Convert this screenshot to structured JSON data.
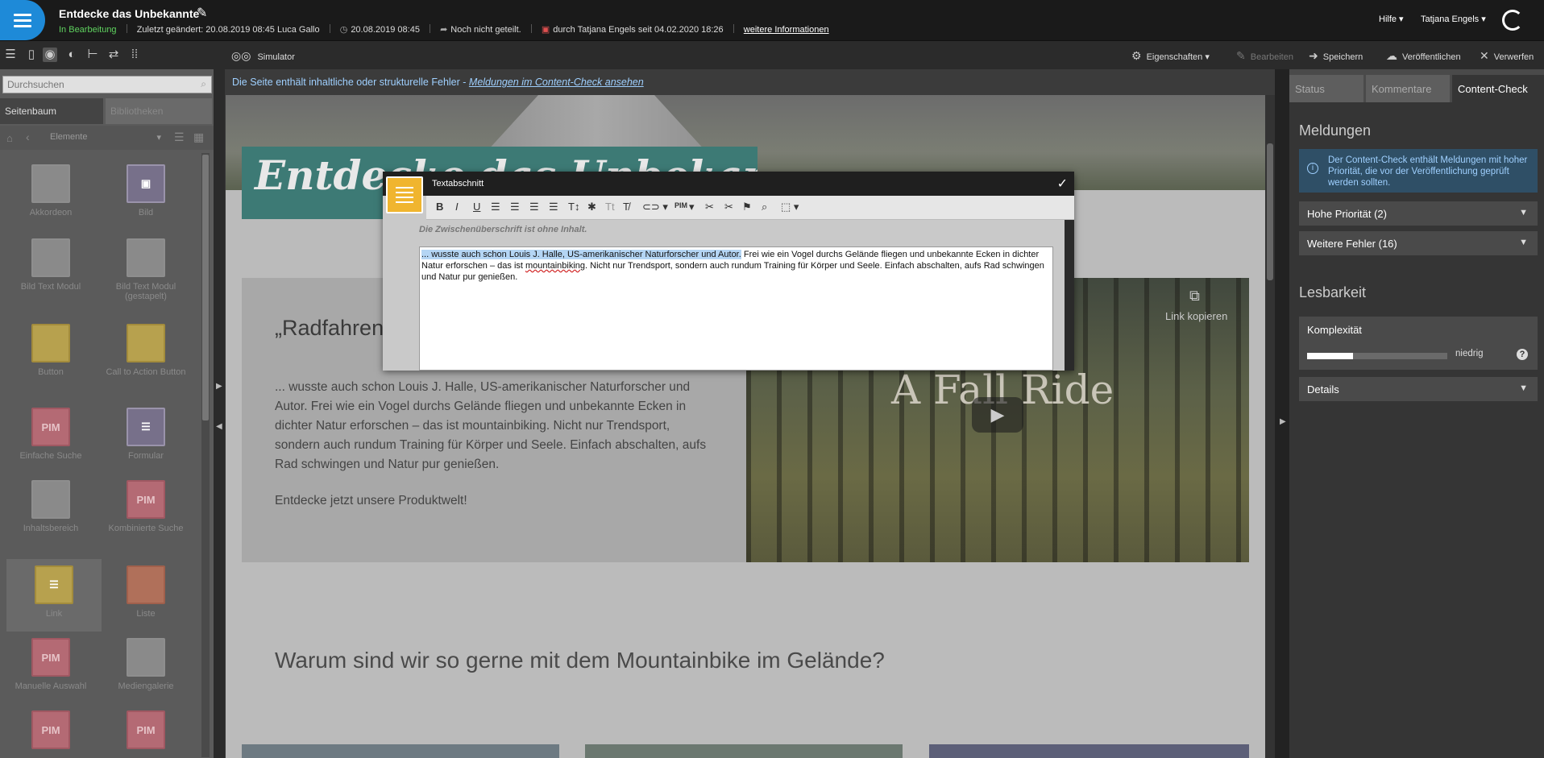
{
  "topbar": {
    "title": "Entdecke das Unbekannte",
    "status": "In Bearbeitung",
    "changed": "Zuletzt geändert: 20.08.2019 08:45 Luca Gallo",
    "date": "20.08.2019 08:45",
    "shared": "Noch nicht geteilt.",
    "locked": "durch Tatjana Engels seit 04.02.2020 18:26",
    "more_info": "weitere Informationen",
    "help": "Hilfe ▾",
    "user": "Tatjana Engels ▾"
  },
  "toolbar": {
    "simulator": "Simulator",
    "properties": "Eigenschaften ▾",
    "edit": "Bearbeiten",
    "save": "Speichern",
    "publish": "Veröffentlichen",
    "discard": "Verwerfen"
  },
  "left": {
    "search_placeholder": "Durchsuchen",
    "tab_tree": "Seitenbaum",
    "tab_libraries": "Bibliotheken",
    "elements_select": "Elemente",
    "widgets": [
      {
        "label": "Akkordeon",
        "tile": ""
      },
      {
        "label": "Bild",
        "tile": ""
      },
      {
        "label": "Bild Text Modul",
        "tile": ""
      },
      {
        "label": "Bild Text Modul (gestapelt)",
        "tile": ""
      },
      {
        "label": "Button",
        "tile": ""
      },
      {
        "label": "Call to Action Button",
        "tile": ""
      },
      {
        "label": "Einfache Suche",
        "tile": "PIM"
      },
      {
        "label": "Formular",
        "tile": ""
      },
      {
        "label": "Inhaltsbereich",
        "tile": ""
      },
      {
        "label": "Kombinierte Suche",
        "tile": "PIM"
      },
      {
        "label": "Link",
        "tile": ""
      },
      {
        "label": "Liste",
        "tile": ""
      },
      {
        "label": "Manuelle Auswahl",
        "tile": "PIM"
      },
      {
        "label": "Mediengalerie",
        "tile": ""
      },
      {
        "label": "",
        "tile": "PIM"
      },
      {
        "label": "",
        "tile": "PIM"
      }
    ]
  },
  "content": {
    "error_text": "Die Seite enthält inhaltliche oder strukturelle Fehler - ",
    "error_link": "Meldungen im Content-Check ansehen",
    "hero_banner": "Entdecke das Unbekannte",
    "quote": "„Radfahren am nächsten",
    "body": "... wusste auch schon Louis J. Halle, US-amerikanischer Naturforscher und Autor. Frei wie ein Vogel durchs Gelände fliegen und unbekannte Ecken in dichter Natur erforschen – das ist mountainbiking. Nicht nur Trendsport, sondern auch rundum Training für Körper und Seele. Einfach abschalten, aufs Rad schwingen und Natur pur genießen.",
    "cta": "Entdecke jetzt unsere Produktwelt!",
    "video_title": "A Fall Ride",
    "copy_link": "Link kopieren",
    "heading2": "Warum sind wir so gerne mit dem Mountainbike im Gelände?"
  },
  "editor": {
    "title": "Textabschnitt",
    "subheading_note": "Die Zwischenüberschrift ist ohne Inhalt.",
    "text_selected": "... wusste auch schon Louis J. Halle, US-amerikanischer Naturforscher und Autor.",
    "text_part1": " Frei wie ein Vogel durchs Gelände fliegen und unbekannte Ecken in dichter Natur erforschen – das ist ",
    "text_misspelled": "mountainbiking",
    "text_part2": ". Nicht nur Trendsport, sondern auch rundum Training für Körper und Seele. Einfach abschalten, aufs Rad schwingen und Natur pur genießen.",
    "pim": "PIM"
  },
  "right": {
    "tab_status": "Status",
    "tab_comments": "Kommentare",
    "tab_check": "Content-Check",
    "messages_heading": "Meldungen",
    "info": "Der Content-Check enthält Meldungen mit hoher Priorität, die vor der Veröffentlichung geprüft werden sollten.",
    "high_priority": "Hohe Priorität (2)",
    "other_errors": "Weitere Fehler (16)",
    "readability_heading": "Lesbarkeit",
    "complexity": "Komplexität",
    "complexity_value": 0.33,
    "complexity_level": "niedrig",
    "details": "Details"
  }
}
